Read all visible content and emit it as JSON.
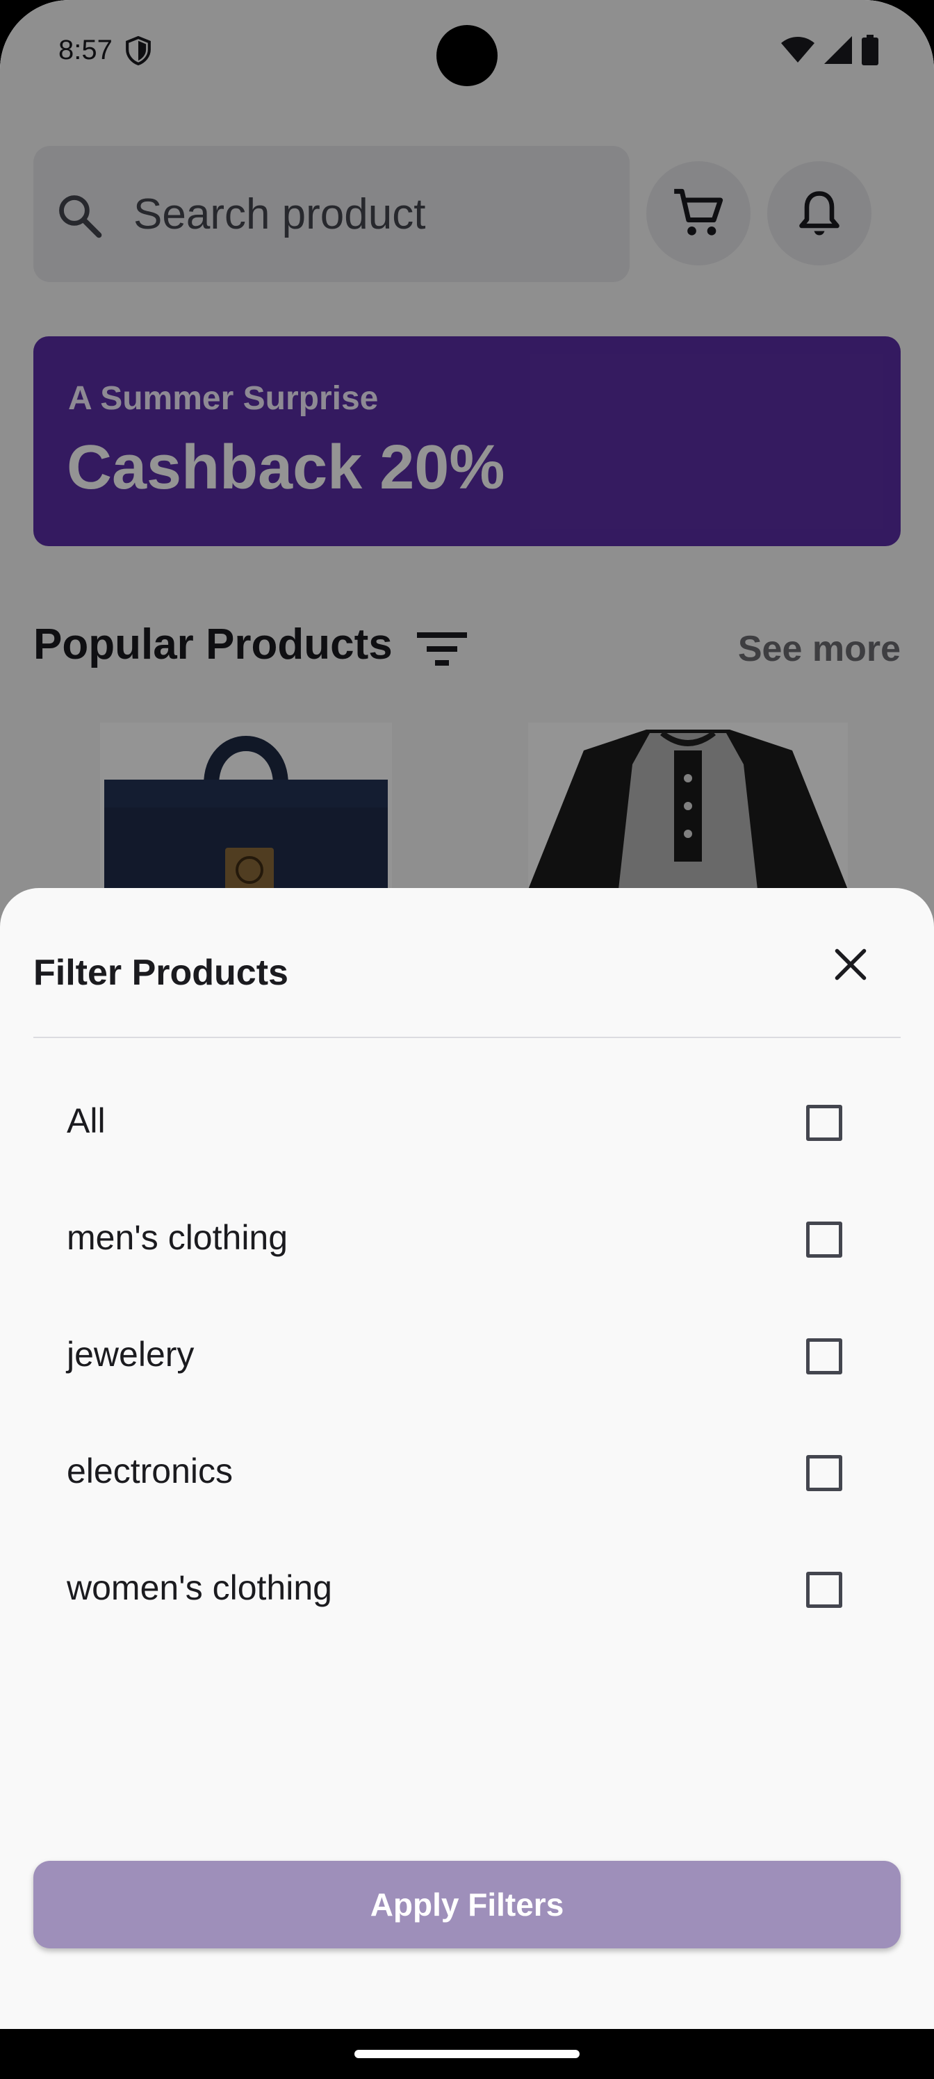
{
  "status_bar": {
    "time": "8:57",
    "icons": [
      "shield-icon",
      "wifi-icon",
      "signal-icon",
      "battery-icon"
    ]
  },
  "search": {
    "placeholder": "Search product",
    "icon": "search-icon"
  },
  "header_actions": [
    "cart-icon",
    "bell-icon"
  ],
  "banner": {
    "subtitle": "A Summer Surprise",
    "title": "Cashback 20%"
  },
  "section": {
    "title": "Popular Products",
    "see_more": "See more"
  },
  "sheet": {
    "title": "Filter Products",
    "options": [
      {
        "label": "All",
        "checked": false
      },
      {
        "label": "men's clothing",
        "checked": false
      },
      {
        "label": "jewelery",
        "checked": false
      },
      {
        "label": "electronics",
        "checked": false
      },
      {
        "label": "women's clothing",
        "checked": false
      }
    ],
    "apply_label": "Apply Filters"
  },
  "colors": {
    "banner": "#5b2ea6",
    "apply_button": "#9e8fba",
    "sheet_bg": "#f9f9f9"
  }
}
